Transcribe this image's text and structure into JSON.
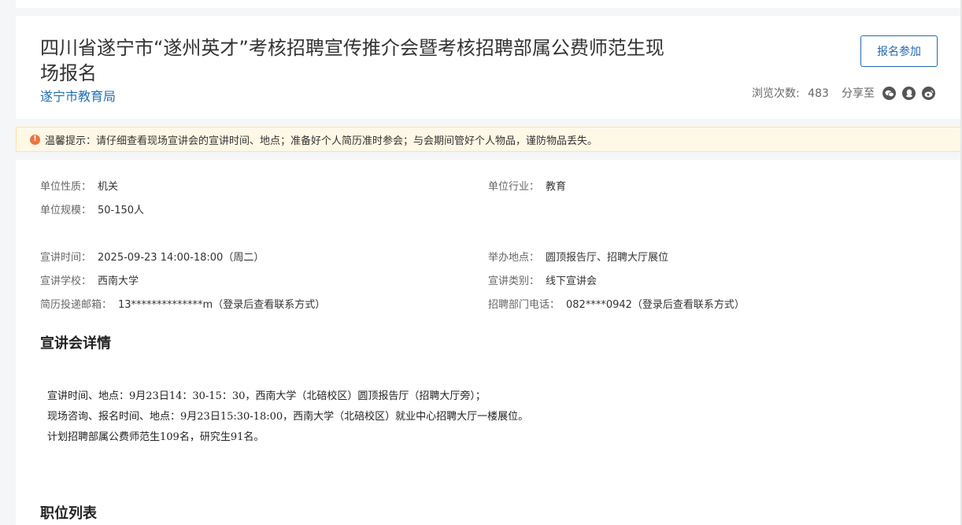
{
  "header": {
    "title": "四川省遂宁市“遂州英才”考核招聘宣传推介会暨考核招聘部属公费师范生现场报名",
    "organization": "遂宁市教育局",
    "signup_label": "报名参加",
    "views_label": "浏览次数:",
    "views_count": "483",
    "share_label": "分享至",
    "share_icons": [
      "wechat-icon",
      "qq-icon",
      "weibo-icon"
    ]
  },
  "notice": {
    "text": "温馨提示：请仔细查看现场宣讲会的宣讲时间、地点；准备好个人简历准时参会；与会期间管好个人物品，谨防物品丢失。"
  },
  "unit_info": {
    "nature_label": "单位性质：",
    "nature_value": "机关",
    "industry_label": "单位行业：",
    "industry_value": "教育",
    "scale_label": "单位规模：",
    "scale_value": "50-150人"
  },
  "event_info": {
    "time_label": "宣讲时间：",
    "time_value": "2025-09-23 14:00-18:00（周二）",
    "venue_label": "举办地点：",
    "venue_value": "圆顶报告厅、招聘大厅展位",
    "school_label": "宣讲学校：",
    "school_value": "西南大学",
    "type_label": "宣讲类别：",
    "type_value": "线下宣讲会",
    "email_label": "简历投递邮箱：",
    "email_value": "13**************m（登录后查看联系方式）",
    "phone_label": "招聘部门电话：",
    "phone_value": "082****0942（登录后查看联系方式）"
  },
  "details": {
    "title": "宣讲会详情",
    "lines": [
      "宣讲时间、地点：9月23日14：30-15：30，西南大学（北碚校区）圆顶报告厅（招聘大厅旁）；",
      "现场咨询、报名时间、地点：9月23日15:30-18:00，西南大学（北碚校区）就业中心招聘大厅一楼展位。",
      "计划招聘部属公费师范生109名，研究生91名。"
    ]
  },
  "positions": {
    "title": "职位列表"
  },
  "colors": {
    "accent": "#2468b2",
    "link": "#1f6fb5",
    "notice_bg": "#fff8e6",
    "notice_border": "#ffe2a6",
    "warning_icon": "#f0723c"
  }
}
